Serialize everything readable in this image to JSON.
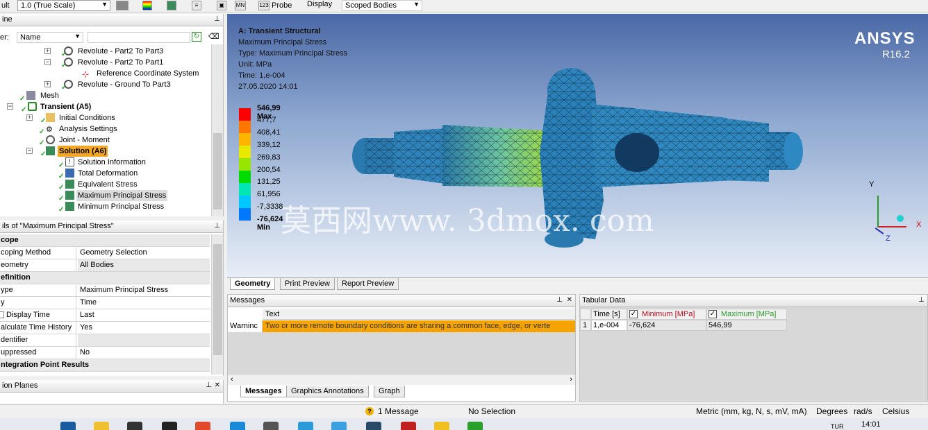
{
  "toolbar": {
    "result_label": "ult",
    "scale_value": "1.0 (True Scale)",
    "probe_label": "Probe",
    "display_label": "Display",
    "display_value": "Scoped Bodies"
  },
  "outline": {
    "title": "ine",
    "filter_label": "er:",
    "filter_value": "Name",
    "items": [
      {
        "label": "Revolute - Part2 To Part3"
      },
      {
        "label": "Revolute - Part2 To Part1"
      },
      {
        "label": "Reference Coordinate System"
      },
      {
        "label": "Revolute - Ground To Part3"
      },
      {
        "label": "Mesh"
      },
      {
        "label": "Transient (A5)"
      },
      {
        "label": "Initial Conditions"
      },
      {
        "label": "Analysis Settings"
      },
      {
        "label": "Joint - Moment"
      },
      {
        "label": "Solution (A6)"
      },
      {
        "label": "Solution Information"
      },
      {
        "label": "Total Deformation"
      },
      {
        "label": "Equivalent Stress"
      },
      {
        "label": "Maximum Principal Stress"
      },
      {
        "label": "Minimum Principal Stress"
      }
    ]
  },
  "details": {
    "title": "ils of \"Maximum Principal Stress\"",
    "rows": [
      {
        "k": "cope",
        "v": ""
      },
      {
        "k": "coping Method",
        "v": "Geometry Selection"
      },
      {
        "k": "eometry",
        "v": "All Bodies"
      },
      {
        "k": "efinition",
        "v": ""
      },
      {
        "k": "ype",
        "v": "Maximum Principal Stress"
      },
      {
        "k": "y",
        "v": "Time"
      },
      {
        "k": "Display Time",
        "v": "Last"
      },
      {
        "k": "alculate Time History",
        "v": "Yes"
      },
      {
        "k": "dentifier",
        "v": ""
      },
      {
        "k": "uppressed",
        "v": "No"
      },
      {
        "k": "ntegration Point Results",
        "v": ""
      }
    ]
  },
  "section_planes": {
    "title": "ion Planes"
  },
  "viewport": {
    "lines": [
      "A: Transient Structural",
      "Maximum Principal Stress",
      "Type: Maximum Principal Stress",
      "Unit: MPa",
      "Time: 1,e-004",
      "27.05.2020 14:01"
    ],
    "brand": "ANSYS",
    "version": "R16.2",
    "watermark": "莫西网www. 3dmox. com",
    "legend": [
      "546,99 Max",
      "477,7",
      "408,41",
      "339,12",
      "269,83",
      "200,54",
      "131,25",
      "61,956",
      "-7,3338",
      "-76,624 Min"
    ],
    "legend_colors": [
      "#ff0000",
      "#ff7700",
      "#ffb400",
      "#e8e800",
      "#96e600",
      "#00dc00",
      "#00e6b4",
      "#00c8ff",
      "#0078ff",
      "#0000ff"
    ],
    "axis": {
      "x": "X",
      "y": "Y",
      "z": "Z"
    },
    "tabs": [
      "Geometry",
      "Print Preview",
      "Report Preview"
    ]
  },
  "messages": {
    "title": "Messages",
    "col_text": "Text",
    "row_type": "Warninc",
    "row_text": "Two or more remote boundary conditions are sharing a common face, edge, or verte",
    "tabs": [
      "Messages",
      "Graphics Annotations",
      "Graph"
    ]
  },
  "tabular": {
    "title": "Tabular Data",
    "col_time": "Time [s]",
    "col_min": "Minimum [MPa]",
    "col_max": "Maximum [MPa]",
    "row_idx": "1",
    "row_time": "1,e-004",
    "row_min": "-76,624",
    "row_max": "546,99"
  },
  "status": {
    "message": "1 Message",
    "selection": "No Selection",
    "units": "Metric (mm, kg, N, s, mV, mA)",
    "degrees": "Degrees",
    "rads": "rad/s",
    "temp": "Celsius"
  },
  "taskbar": {
    "time": "14:01",
    "lang": "TUR"
  }
}
